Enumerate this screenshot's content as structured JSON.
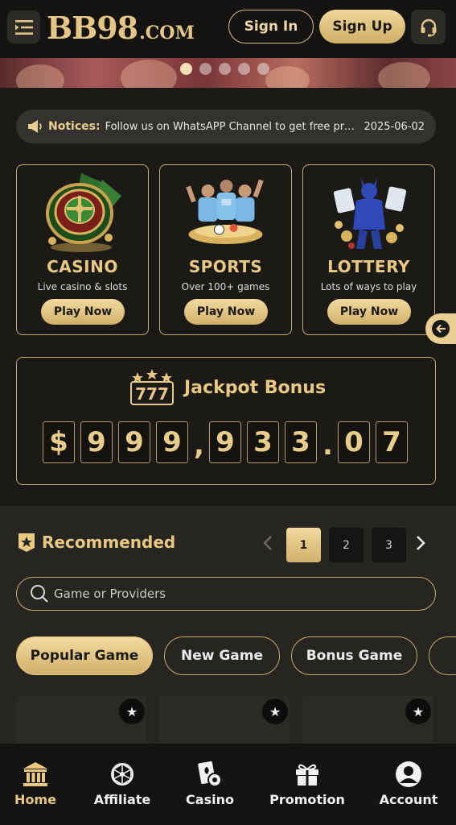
{
  "header": {
    "logo_main": "BB98",
    "logo_suffix": ".COM",
    "signin_label": "Sign In",
    "signup_label": "Sign Up",
    "menu_icon": "menu-icon",
    "support_icon": "headset-icon"
  },
  "banner": {
    "slide_count": 5,
    "active_slide": 1
  },
  "notice": {
    "label": "Notices:",
    "text": "Follow us on WhatsAPP Channel to get free promo c...",
    "date": "2025-06-02"
  },
  "games": [
    {
      "title": "CASINO",
      "subtitle": "Live casino & slots",
      "button": "Play Now",
      "icon": "roulette-icon"
    },
    {
      "title": "SPORTS",
      "subtitle": "Over 100+ games",
      "button": "Play Now",
      "icon": "football-players-icon"
    },
    {
      "title": "LOTTERY",
      "subtitle": "Lots of ways to play",
      "button": "Play Now",
      "icon": "lottery-heroine-icon"
    }
  ],
  "jackpot": {
    "title": "Jackpot Bonus",
    "badge": "777",
    "amount": "$999,933.07"
  },
  "recommended": {
    "title": "Recommended",
    "pages": [
      "1",
      "2",
      "3"
    ],
    "active_page": "1"
  },
  "search": {
    "placeholder": "Game or Providers"
  },
  "categories": [
    "Popular Game",
    "New Game",
    "Bonus Game"
  ],
  "active_category": "Popular Game",
  "bottom_nav": [
    {
      "label": "Home",
      "icon": "bank-icon"
    },
    {
      "label": "Affiliate",
      "icon": "network-icon"
    },
    {
      "label": "Casino",
      "icon": "cards-icon"
    },
    {
      "label": "Promotion",
      "icon": "gift-icon"
    },
    {
      "label": "Account",
      "icon": "user-icon"
    }
  ],
  "active_nav": "Home",
  "colors": {
    "accent_gold": "#e8c882",
    "background": "#1b1a17",
    "panel": "#262521"
  }
}
